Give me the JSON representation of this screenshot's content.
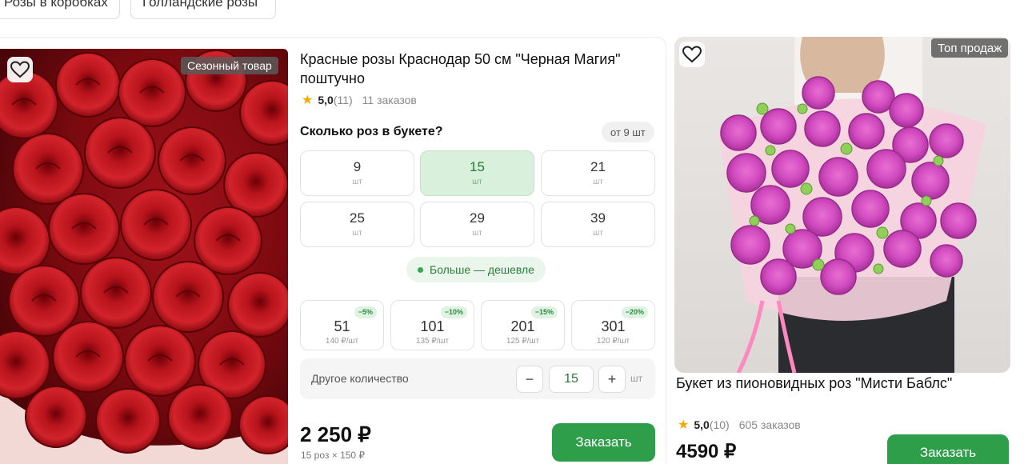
{
  "categories": [
    "Розы в коробках",
    "Голландские розы"
  ],
  "product1": {
    "badge": "Сезонный товар",
    "title": "Красные розы Краснодар 50 см \"Черная Магия\" поштучно",
    "rating": "5,0",
    "reviews": "(11)",
    "orders": "11 заказов",
    "quantity_question": "Сколько роз в букете?",
    "min_note": "от 9 шт",
    "unit_short": "шт",
    "quantities": [
      {
        "n": "9",
        "u": "шт",
        "selected": false
      },
      {
        "n": "15",
        "u": "шт",
        "selected": true
      },
      {
        "n": "21",
        "u": "шт",
        "selected": false
      },
      {
        "n": "25",
        "u": "шт",
        "selected": false
      },
      {
        "n": "29",
        "u": "шт",
        "selected": false
      },
      {
        "n": "39",
        "u": "шт",
        "selected": false
      }
    ],
    "more_cheaper": "Больше — дешевле",
    "bulk": [
      {
        "n": "51",
        "price": "140 ₽/шт",
        "discount": "−5%"
      },
      {
        "n": "101",
        "price": "135 ₽/шт",
        "discount": "−10%"
      },
      {
        "n": "201",
        "price": "125 ₽/шт",
        "discount": "−15%"
      },
      {
        "n": "301",
        "price": "120 ₽/шт",
        "discount": "−20%"
      }
    ],
    "other_label": "Другое количество",
    "stepper": {
      "minus": "−",
      "value": "15",
      "plus": "+",
      "unit": "шт"
    },
    "price": "2 250 ₽",
    "price_sub": "15 роз × 150 ₽",
    "order_label": "Заказать"
  },
  "product2": {
    "badge": "Топ продаж",
    "title": "Букет из пионовидных роз \"Мисти Баблс\"",
    "rating": "5,0",
    "reviews": "(10)",
    "orders": "605 заказов",
    "price": "4590 ₽",
    "order_label": "Заказать"
  },
  "colors": {
    "accent": "#2f9e4b",
    "selected_bg": "#d8f0dc",
    "star": "#f2a900"
  },
  "icons": {
    "favorite": "heart-outline-icon",
    "rating": "star-icon"
  }
}
